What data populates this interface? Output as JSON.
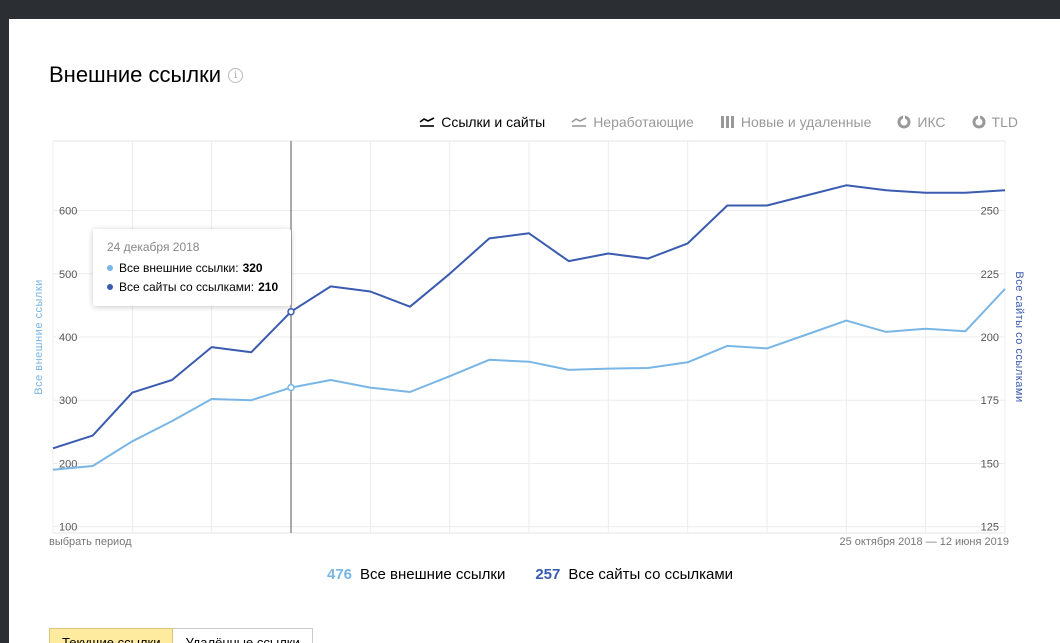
{
  "header": {
    "title": "Внешние ссылки"
  },
  "tabs": [
    {
      "label": "Ссылки и сайты",
      "icon": "line-chart-icon",
      "active": true
    },
    {
      "label": "Неработающие",
      "icon": "line-chart-icon",
      "active": false
    },
    {
      "label": "Новые и удаленные",
      "icon": "bar-chart-icon",
      "active": false
    },
    {
      "label": "ИКС",
      "icon": "pie-chart-icon",
      "active": false
    },
    {
      "label": "TLD",
      "icon": "pie-chart-icon",
      "active": false
    }
  ],
  "tooltip": {
    "date": "24 декабря 2018",
    "rows": [
      {
        "label": "Все внешние ссылки:",
        "value": "320"
      },
      {
        "label": "Все сайты со ссылками:",
        "value": "210"
      }
    ]
  },
  "footer": {
    "period_link": "выбрать период",
    "range": "25 октября 2018 — 12 июня 2019"
  },
  "legend": [
    {
      "value": "476",
      "label": "Все внешние ссылки",
      "color": "#79b6e6"
    },
    {
      "value": "257",
      "label": "Все сайты со ссылками",
      "color": "#3a5bb0"
    }
  ],
  "buttons": {
    "current": "Текущие ссылки",
    "deleted": "Удалённые ссылки"
  },
  "colors": {
    "links": "#79b6e6",
    "sites": "#3a5bb0"
  },
  "chart_data": {
    "type": "line",
    "ylabel": "Все внешние ссылки",
    "y2label": "Все сайты со ссылками",
    "ylim": [
      90,
      710
    ],
    "y2lim": [
      122.5,
      277.5
    ],
    "yticks": [
      100,
      200,
      300,
      400,
      500,
      600
    ],
    "y2ticks": [
      125,
      150,
      175,
      200,
      225,
      250
    ],
    "highlight_index": 6,
    "series": [
      {
        "name": "Все внешние ссылки",
        "axis": "left",
        "values": [
          190,
          196,
          235,
          267,
          302,
          300,
          320,
          332,
          320,
          313,
          338,
          364,
          361,
          348,
          350,
          351,
          360,
          386,
          382,
          404,
          426,
          408,
          413,
          409,
          476
        ]
      },
      {
        "name": "Все сайты со ссылками",
        "axis": "right",
        "values": [
          156,
          161,
          178,
          183,
          196,
          194,
          210,
          220,
          218,
          212,
          225,
          239,
          241,
          230,
          233,
          231,
          237,
          252,
          252,
          256,
          260,
          258,
          257,
          257,
          258
        ]
      }
    ]
  }
}
